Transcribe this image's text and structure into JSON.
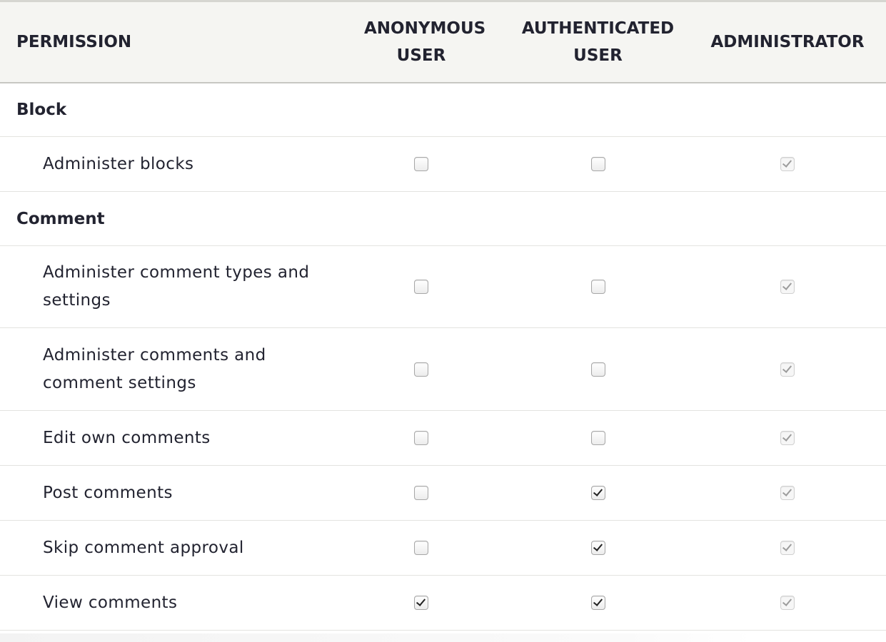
{
  "table": {
    "headers": {
      "permission": "PERMISSION",
      "roles": [
        "ANONYMOUS USER",
        "AUTHENTICATED USER",
        "ADMINISTRATOR"
      ]
    },
    "groups": [
      {
        "name": "Block",
        "permissions": [
          {
            "label": "Administer blocks",
            "anonymous": false,
            "authenticated": false,
            "administrator": true
          }
        ]
      },
      {
        "name": "Comment",
        "permissions": [
          {
            "label": "Administer comment types and settings",
            "anonymous": false,
            "authenticated": false,
            "administrator": true
          },
          {
            "label": "Administer comments and comment settings",
            "anonymous": false,
            "authenticated": false,
            "administrator": true
          },
          {
            "label": "Edit own comments",
            "anonymous": false,
            "authenticated": false,
            "administrator": true
          },
          {
            "label": "Post comments",
            "anonymous": false,
            "authenticated": true,
            "administrator": true
          },
          {
            "label": "Skip comment approval",
            "anonymous": false,
            "authenticated": true,
            "administrator": true
          },
          {
            "label": "View comments",
            "anonymous": true,
            "authenticated": true,
            "administrator": true
          }
        ]
      }
    ],
    "administrator_checkboxes_disabled": true
  },
  "colors": {
    "header_bg": "#f5f5f2",
    "text": "#222330",
    "row_border": "#e3e3e0"
  }
}
